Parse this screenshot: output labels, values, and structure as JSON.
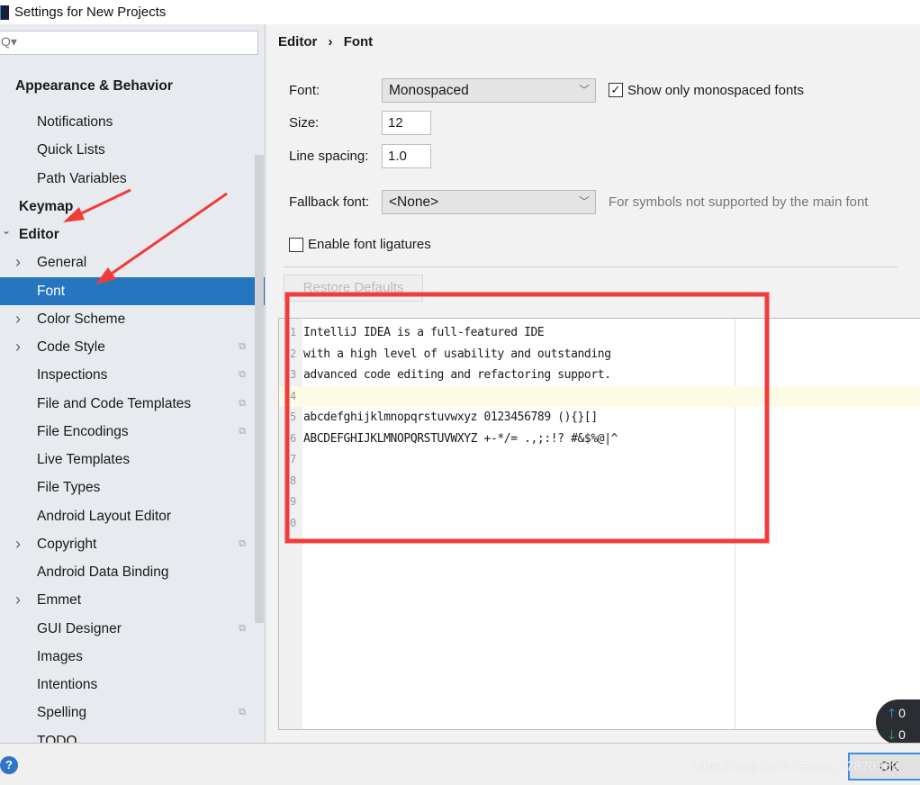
{
  "window": {
    "title": "Settings for New Projects"
  },
  "sidebar": {
    "search_placeholder": "Q▾",
    "items": [
      {
        "label": "Appearance & Behavior",
        "bold": true
      },
      {
        "label": "Notifications"
      },
      {
        "label": "Quick Lists"
      },
      {
        "label": "Path Variables"
      },
      {
        "label": "Keymap",
        "bold": true
      },
      {
        "label": "Editor",
        "bold": true,
        "expanded": true
      },
      {
        "label": "General",
        "expandable": true
      },
      {
        "label": "Font",
        "selected": true
      },
      {
        "label": "Color Scheme",
        "expandable": true
      },
      {
        "label": "Code Style",
        "expandable": true,
        "project_icon": true
      },
      {
        "label": "Inspections",
        "project_icon": true
      },
      {
        "label": "File and Code Templates",
        "project_icon": true
      },
      {
        "label": "File Encodings",
        "project_icon": true
      },
      {
        "label": "Live Templates"
      },
      {
        "label": "File Types"
      },
      {
        "label": "Android Layout Editor"
      },
      {
        "label": "Copyright",
        "expandable": true,
        "project_icon": true
      },
      {
        "label": "Android Data Binding"
      },
      {
        "label": "Emmet",
        "expandable": true
      },
      {
        "label": "GUI Designer",
        "project_icon": true
      },
      {
        "label": "Images"
      },
      {
        "label": "Intentions"
      },
      {
        "label": "Spelling",
        "project_icon": true
      },
      {
        "label": "TODO"
      }
    ]
  },
  "breadcrumb": {
    "parent": "Editor",
    "sep": "›",
    "current": "Font"
  },
  "form": {
    "font_label": "Font:",
    "font_value": "Monospaced",
    "show_mono_label": "Show only monospaced fonts",
    "show_mono_checked": true,
    "size_label": "Size:",
    "size_value": "12",
    "spacing_label": "Line spacing:",
    "spacing_value": "1.0",
    "fallback_label": "Fallback font:",
    "fallback_value": "<None>",
    "fallback_hint": "For symbols not supported by the main font",
    "ligatures_label": "Enable font ligatures",
    "ligatures_checked": false,
    "restore_label": "Restore Defaults"
  },
  "preview": {
    "lines": [
      {
        "num": "1",
        "text": "IntelliJ IDEA is a full-featured IDE"
      },
      {
        "num": "2",
        "text": "with a high level of usability and outstanding"
      },
      {
        "num": "3",
        "text": "advanced code editing and refactoring support."
      },
      {
        "num": "4",
        "text": ""
      },
      {
        "num": "5",
        "text": "abcdefghijklmnopqrstuvwxyz 0123456789 (){}[]"
      },
      {
        "num": "6",
        "text": "ABCDEFGHIJKLMNOPQRSTUVWXYZ +-*/= .,;:!? #&$%@|^"
      },
      {
        "num": "7",
        "text": ""
      },
      {
        "num": "8",
        "text": ""
      },
      {
        "num": "9",
        "text": ""
      },
      {
        "num": "0",
        "text": ""
      }
    ]
  },
  "footer": {
    "help": "?",
    "ok": "OK",
    "watermark": "https://blog.csdn.net/qq_37870369"
  },
  "network": {
    "up": "0",
    "down": "0"
  },
  "colors": {
    "selection": "#2675bf",
    "annotation": "#f03c3c"
  }
}
